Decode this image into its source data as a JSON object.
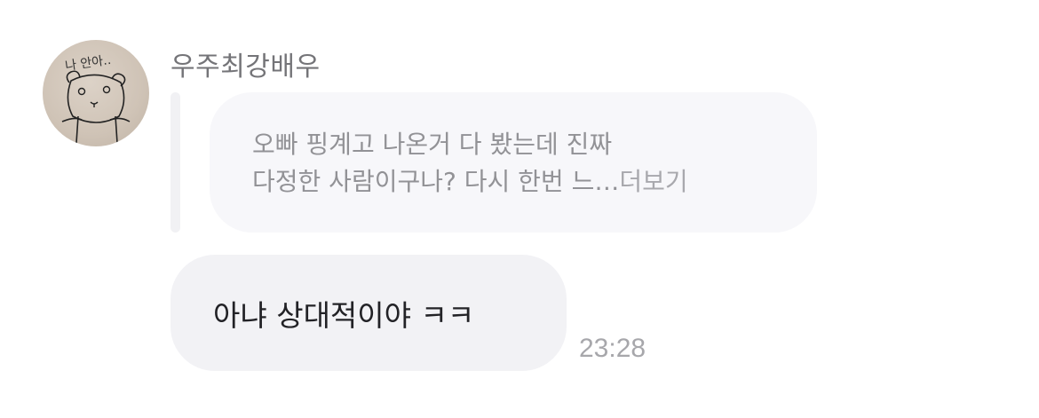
{
  "sender": {
    "name": "우주최강배우",
    "avatar_caption": "나 안아.."
  },
  "reply_quote": {
    "line1": "오빠 핑계고 나온거 다 봤는데 진짜",
    "line2": "다정한 사람이구나? 다시 한번 느…",
    "more_label": "더보기"
  },
  "message": {
    "text": "아냐 상대적이야 ㅋㅋ",
    "time": "23:28"
  }
}
